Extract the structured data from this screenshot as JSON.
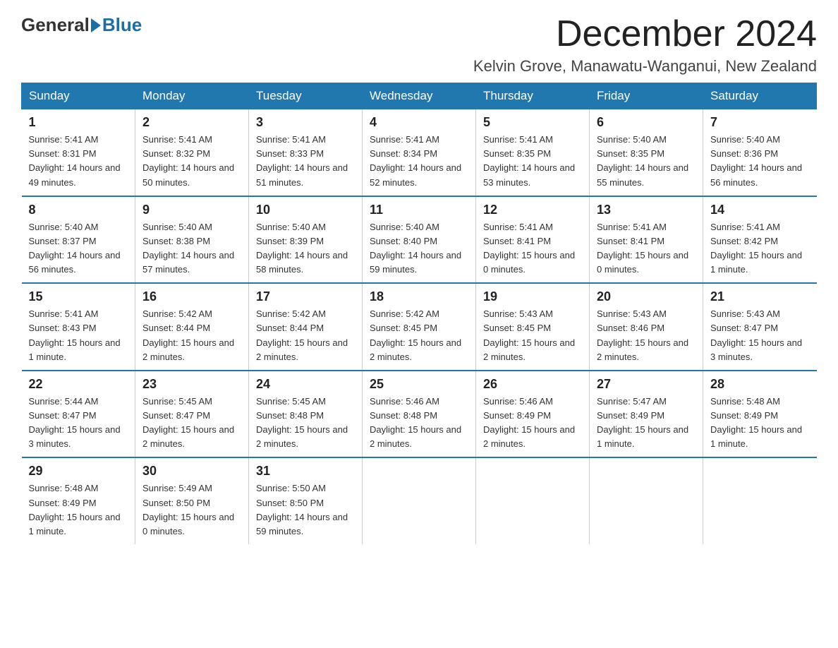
{
  "header": {
    "logo_general": "General",
    "logo_blue": "Blue",
    "month_title": "December 2024",
    "location": "Kelvin Grove, Manawatu-Wanganui, New Zealand"
  },
  "days_of_week": [
    "Sunday",
    "Monday",
    "Tuesday",
    "Wednesday",
    "Thursday",
    "Friday",
    "Saturday"
  ],
  "weeks": [
    [
      {
        "day": "1",
        "sunrise": "5:41 AM",
        "sunset": "8:31 PM",
        "daylight": "14 hours and 49 minutes."
      },
      {
        "day": "2",
        "sunrise": "5:41 AM",
        "sunset": "8:32 PM",
        "daylight": "14 hours and 50 minutes."
      },
      {
        "day": "3",
        "sunrise": "5:41 AM",
        "sunset": "8:33 PM",
        "daylight": "14 hours and 51 minutes."
      },
      {
        "day": "4",
        "sunrise": "5:41 AM",
        "sunset": "8:34 PM",
        "daylight": "14 hours and 52 minutes."
      },
      {
        "day": "5",
        "sunrise": "5:41 AM",
        "sunset": "8:35 PM",
        "daylight": "14 hours and 53 minutes."
      },
      {
        "day": "6",
        "sunrise": "5:40 AM",
        "sunset": "8:35 PM",
        "daylight": "14 hours and 55 minutes."
      },
      {
        "day": "7",
        "sunrise": "5:40 AM",
        "sunset": "8:36 PM",
        "daylight": "14 hours and 56 minutes."
      }
    ],
    [
      {
        "day": "8",
        "sunrise": "5:40 AM",
        "sunset": "8:37 PM",
        "daylight": "14 hours and 56 minutes."
      },
      {
        "day": "9",
        "sunrise": "5:40 AM",
        "sunset": "8:38 PM",
        "daylight": "14 hours and 57 minutes."
      },
      {
        "day": "10",
        "sunrise": "5:40 AM",
        "sunset": "8:39 PM",
        "daylight": "14 hours and 58 minutes."
      },
      {
        "day": "11",
        "sunrise": "5:40 AM",
        "sunset": "8:40 PM",
        "daylight": "14 hours and 59 minutes."
      },
      {
        "day": "12",
        "sunrise": "5:41 AM",
        "sunset": "8:41 PM",
        "daylight": "15 hours and 0 minutes."
      },
      {
        "day": "13",
        "sunrise": "5:41 AM",
        "sunset": "8:41 PM",
        "daylight": "15 hours and 0 minutes."
      },
      {
        "day": "14",
        "sunrise": "5:41 AM",
        "sunset": "8:42 PM",
        "daylight": "15 hours and 1 minute."
      }
    ],
    [
      {
        "day": "15",
        "sunrise": "5:41 AM",
        "sunset": "8:43 PM",
        "daylight": "15 hours and 1 minute."
      },
      {
        "day": "16",
        "sunrise": "5:42 AM",
        "sunset": "8:44 PM",
        "daylight": "15 hours and 2 minutes."
      },
      {
        "day": "17",
        "sunrise": "5:42 AM",
        "sunset": "8:44 PM",
        "daylight": "15 hours and 2 minutes."
      },
      {
        "day": "18",
        "sunrise": "5:42 AM",
        "sunset": "8:45 PM",
        "daylight": "15 hours and 2 minutes."
      },
      {
        "day": "19",
        "sunrise": "5:43 AM",
        "sunset": "8:45 PM",
        "daylight": "15 hours and 2 minutes."
      },
      {
        "day": "20",
        "sunrise": "5:43 AM",
        "sunset": "8:46 PM",
        "daylight": "15 hours and 2 minutes."
      },
      {
        "day": "21",
        "sunrise": "5:43 AM",
        "sunset": "8:47 PM",
        "daylight": "15 hours and 3 minutes."
      }
    ],
    [
      {
        "day": "22",
        "sunrise": "5:44 AM",
        "sunset": "8:47 PM",
        "daylight": "15 hours and 3 minutes."
      },
      {
        "day": "23",
        "sunrise": "5:45 AM",
        "sunset": "8:47 PM",
        "daylight": "15 hours and 2 minutes."
      },
      {
        "day": "24",
        "sunrise": "5:45 AM",
        "sunset": "8:48 PM",
        "daylight": "15 hours and 2 minutes."
      },
      {
        "day": "25",
        "sunrise": "5:46 AM",
        "sunset": "8:48 PM",
        "daylight": "15 hours and 2 minutes."
      },
      {
        "day": "26",
        "sunrise": "5:46 AM",
        "sunset": "8:49 PM",
        "daylight": "15 hours and 2 minutes."
      },
      {
        "day": "27",
        "sunrise": "5:47 AM",
        "sunset": "8:49 PM",
        "daylight": "15 hours and 1 minute."
      },
      {
        "day": "28",
        "sunrise": "5:48 AM",
        "sunset": "8:49 PM",
        "daylight": "15 hours and 1 minute."
      }
    ],
    [
      {
        "day": "29",
        "sunrise": "5:48 AM",
        "sunset": "8:49 PM",
        "daylight": "15 hours and 1 minute."
      },
      {
        "day": "30",
        "sunrise": "5:49 AM",
        "sunset": "8:50 PM",
        "daylight": "15 hours and 0 minutes."
      },
      {
        "day": "31",
        "sunrise": "5:50 AM",
        "sunset": "8:50 PM",
        "daylight": "14 hours and 59 minutes."
      },
      null,
      null,
      null,
      null
    ]
  ]
}
